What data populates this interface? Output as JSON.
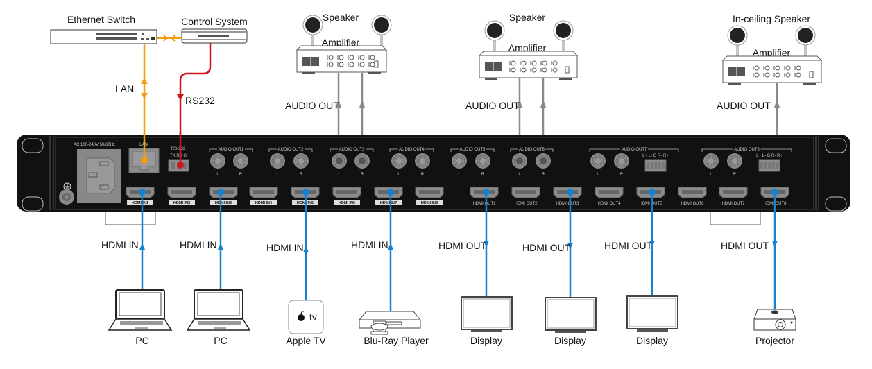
{
  "colors": {
    "lan": "#f29c11",
    "rs232": "#d0121b",
    "hdmi": "#1482d0",
    "audio": "#8a8a8a",
    "chassis": "#111111",
    "port": "#8c8c8c"
  },
  "top_devices": {
    "ethernet_switch": "Ethernet Switch",
    "control_system": "Control System",
    "lan_label": "LAN",
    "rs232_label": "RS232"
  },
  "audio_zones": [
    {
      "speaker_label": "Speaker",
      "amp_label": "Amplifier",
      "link_label": "AUDIO OUT"
    },
    {
      "speaker_label": "Speaker",
      "amp_label": "Amplifier",
      "link_label": "AUDIO OUT"
    },
    {
      "speaker_label": "In-ceiling Speaker",
      "amp_label": "Amplifier",
      "link_label": "AUDIO OUT"
    }
  ],
  "panel": {
    "power_label": "AC 100-240V 50/60Hz",
    "lan_port": "LAN",
    "rs232_port": "RS-232",
    "rs232_pins": "TX RX G",
    "phoenix_pins": "L+ L- G R- R+",
    "audio_outs": [
      "AUDIO OUT1",
      "AUDIO OUT2",
      "AUDIO OUT3",
      "AUDIO OUT4",
      "AUDIO OUT5",
      "AUDIO OUT6",
      "AUDIO OUT7",
      "AUDIO OUT8"
    ],
    "lr": [
      "L",
      "R"
    ],
    "hdmi_in": [
      "HDMI IN1",
      "HDMI IN2",
      "HDMI IN3",
      "HDMI IN4",
      "HDMI IN5",
      "HDMI IN6",
      "HDMI IN7",
      "HDMI IN8"
    ],
    "hdmi_out": [
      "HDMI OUT1",
      "HDMI OUT2",
      "HDMI OUT3",
      "HDMI OUT4",
      "HDMI OUT5",
      "HDMI OUT6",
      "HDMI OUT7",
      "HDMI OUT8"
    ]
  },
  "sources": [
    {
      "name": "PC",
      "link_label": "HDMI IN",
      "port": "HDMI IN1"
    },
    {
      "name": "PC",
      "link_label": "HDMI IN",
      "port": "HDMI IN3"
    },
    {
      "name": "Apple TV",
      "link_label": "HDMI IN",
      "port": "HDMI IN5",
      "logo_text": "tv"
    },
    {
      "name": "Blu-Ray Player",
      "link_label": "HDMI IN",
      "port": "HDMI IN7"
    }
  ],
  "sinks": [
    {
      "name": "Display",
      "link_label": "HDMI OUT",
      "port": "HDMI OUT1"
    },
    {
      "name": "Display",
      "link_label": "HDMI OUT",
      "port": "HDMI OUT3"
    },
    {
      "name": "Display",
      "link_label": "HDMI OUT",
      "port": "HDMI OUT5"
    },
    {
      "name": "Projector",
      "link_label": "HDMI OUT",
      "port": "HDMI OUT8"
    }
  ]
}
